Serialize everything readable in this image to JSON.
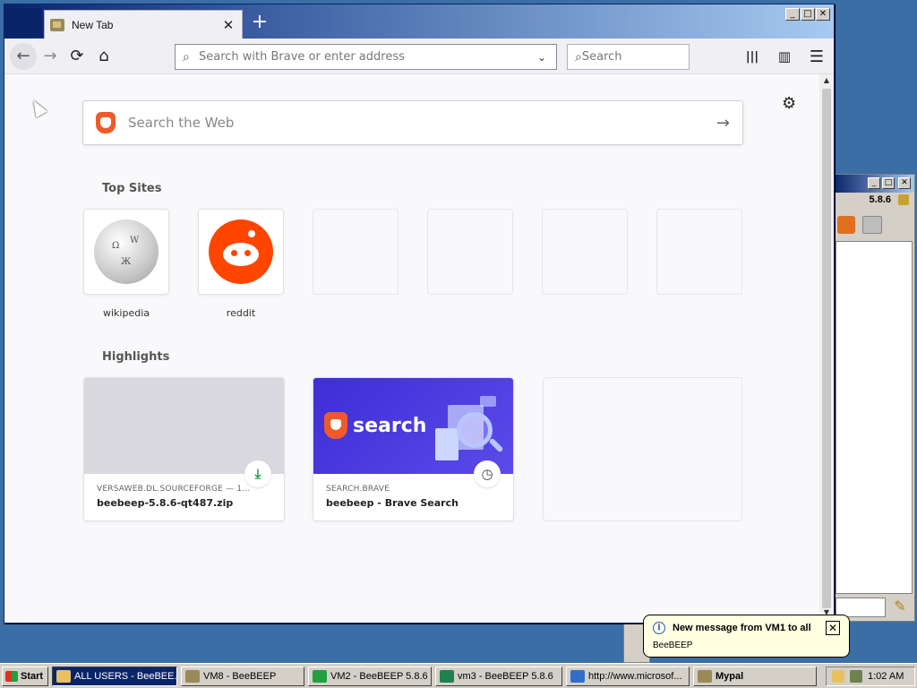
{
  "browser": {
    "tab": {
      "title": "New Tab",
      "close": "✕"
    },
    "new_tab": "+",
    "window_controls": {
      "minimize": "_",
      "maximize": "□",
      "close": "✕"
    },
    "nav": {
      "back_icon": "←",
      "forward_icon": "→",
      "reload_icon": "⟳",
      "home_icon": "⌂",
      "address_placeholder": "Search with Brave or enter address",
      "address_dropdown_icon": "⌄",
      "search_placeholder": "Search",
      "library_icon": "|||",
      "sidebar_icon": "▥",
      "menu_icon": "☰"
    }
  },
  "newtab": {
    "settings_icon": "⚙",
    "web_search_placeholder": "Search the Web",
    "web_search_arrow": "→",
    "top_sites_heading": "Top Sites",
    "top_sites": [
      {
        "label": "wikipedia"
      },
      {
        "label": "reddit"
      },
      {
        "label": ""
      },
      {
        "label": ""
      },
      {
        "label": ""
      },
      {
        "label": ""
      }
    ],
    "highlights_heading": "Highlights",
    "highlights": [
      {
        "host": "VERSAWEB.DL.SOURCEFORGE — 1...",
        "title": "beebeep-5.8.6-qt487.zip",
        "badge": "⤓"
      },
      {
        "host": "SEARCH.BRAVE",
        "title": "beebeep - Brave Search",
        "badge": "◷",
        "image_text": "search"
      }
    ]
  },
  "beebeep_window": {
    "version": "5.8.6"
  },
  "notification": {
    "title": "New message from VM1 to all",
    "body": "BeeBEEP",
    "close": "✕",
    "info_icon": "i"
  },
  "taskbar": {
    "start": "Start",
    "tasks": [
      {
        "label": "ALL USERS - BeeBEE...",
        "active": true
      },
      {
        "label": "VM8 - BeeBEEP"
      },
      {
        "label": "VM2 - BeeBEEP 5.8.6"
      },
      {
        "label": "vm3 - BeeBEEP 5.8.6"
      },
      {
        "label": "http://www.microsof..."
      },
      {
        "label": "Mypal"
      }
    ],
    "clock": "1:02 AM"
  },
  "colors": {
    "desktop": "#3a6ea5",
    "titlebar": "#0a246a",
    "brave_orange": "#ef5a2a",
    "reddit": "#ff4500",
    "download_green": "#12a64a",
    "brave_search_purple": "#3d2ed6"
  }
}
